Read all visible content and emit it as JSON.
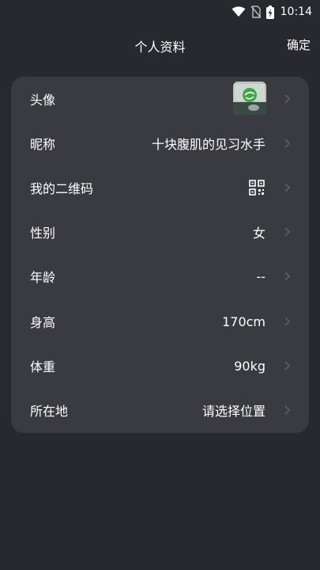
{
  "status_bar": {
    "time": "10:14",
    "icons": [
      "wifi-icon",
      "no-sim-icon",
      "battery-charging-icon"
    ]
  },
  "header": {
    "title": "个人资料",
    "confirm_label": "确定"
  },
  "profile": {
    "avatar_label": "头像",
    "nickname_label": "昵称",
    "nickname_value": "十块腹肌的见习水手",
    "qrcode_label": "我的二维码",
    "gender_label": "性别",
    "gender_value": "女",
    "age_label": "年龄",
    "age_value": "--",
    "height_label": "身高",
    "height_value": "170cm",
    "weight_label": "体重",
    "weight_value": "90kg",
    "location_label": "所在地",
    "location_value": "请选择位置"
  },
  "colors": {
    "background": "#28282f",
    "card": "#3a3a41",
    "chevron": "#5e5e66"
  }
}
